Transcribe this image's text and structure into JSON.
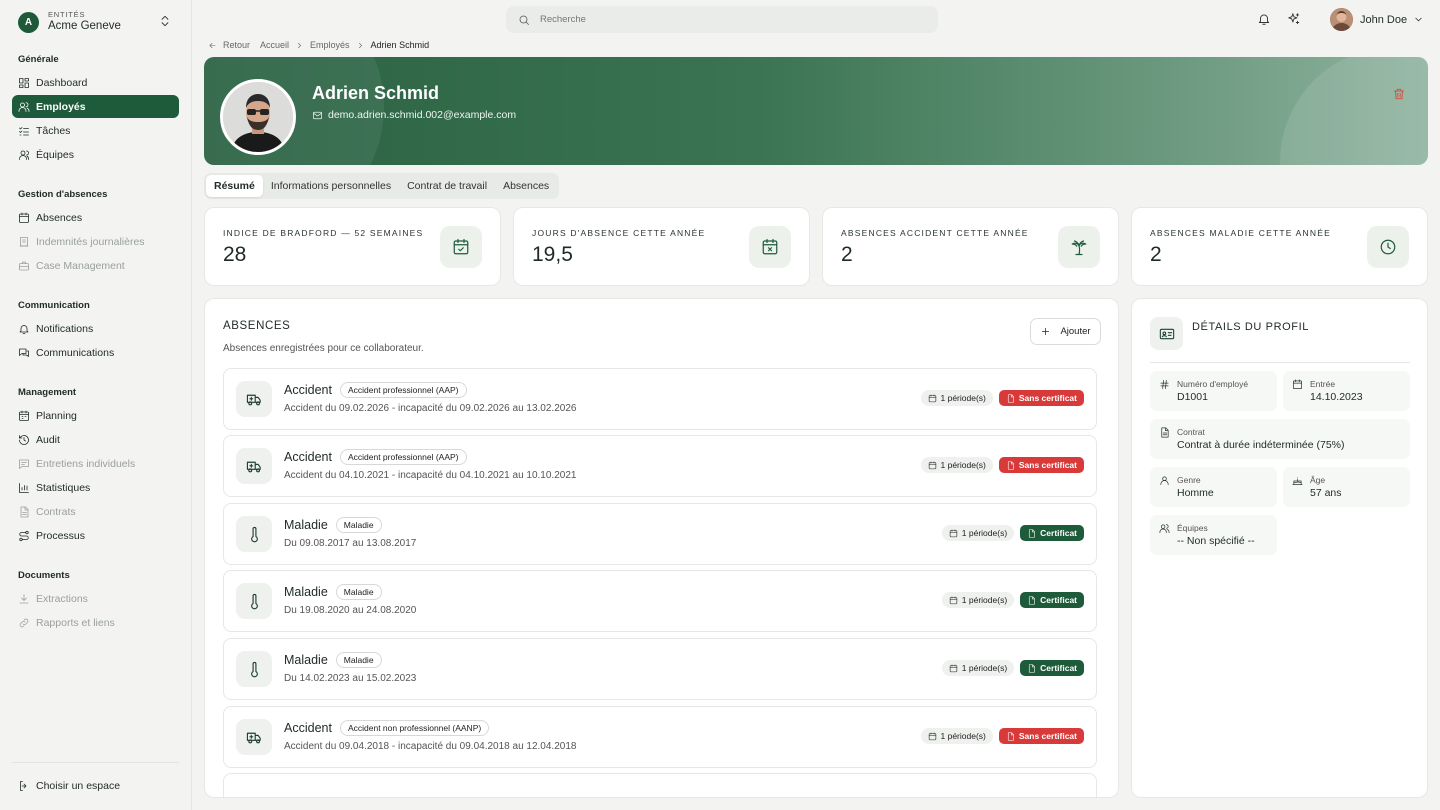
{
  "sidebar": {
    "entity_label": "ENTITÉS",
    "entity_name": "Acme Geneve",
    "entity_initial": "A",
    "sections": {
      "generale": "Générale",
      "absences": "Gestion d'absences",
      "communication": "Communication",
      "management": "Management",
      "documents": "Documents"
    },
    "items": {
      "dashboard": "Dashboard",
      "employes": "Employés",
      "taches": "Tâches",
      "equipes": "Équipes",
      "absences": "Absences",
      "indemnites": "Indemnités journalières",
      "case_management": "Case Management",
      "notifications": "Notifications",
      "communications": "Communications",
      "planning": "Planning",
      "audit": "Audit",
      "entretiens": "Entretiens individuels",
      "statistiques": "Statistiques",
      "contrats": "Contrats",
      "processus": "Processus",
      "extractions": "Extractions",
      "rapports": "Rapports et liens"
    },
    "footer": "Choisir un espace"
  },
  "topbar": {
    "search_placeholder": "Recherche",
    "user_name": "John Doe"
  },
  "breadcrumb": {
    "back": "Retour",
    "home": "Accueil",
    "employees": "Employés",
    "current": "Adrien Schmid"
  },
  "profile": {
    "name": "Adrien Schmid",
    "email": "demo.adrien.schmid.002@example.com"
  },
  "tabs": [
    "Résumé",
    "Informations personnelles",
    "Contrat de travail",
    "Absences"
  ],
  "stats": [
    {
      "label": "Indice de Bradford — 52 semaines",
      "value": "28",
      "icon": "calendar-check-icon"
    },
    {
      "label": "Jours d'absence cette année",
      "value": "19,5",
      "icon": "calendar-x-icon"
    },
    {
      "label": "Absences accident cette année",
      "value": "2",
      "icon": "palm-tree-icon"
    },
    {
      "label": "Absences maladie cette année",
      "value": "2",
      "icon": "clock-icon"
    }
  ],
  "absences": {
    "title": "ABSENCES",
    "subtitle": "Absences enregistrées pour ce collaborateur.",
    "add_label": "Ajouter",
    "items": [
      {
        "type": "Accident",
        "badge": "Accident professionnel (AAP)",
        "desc": "Accident du 09.02.2026 - incapacité du 09.02.2026 au 13.02.2026",
        "periods": "1 période(s)",
        "cert": "Sans certificat",
        "icon": "ambulance-icon"
      },
      {
        "type": "Accident",
        "badge": "Accident professionnel (AAP)",
        "desc": "Accident du 04.10.2021 - incapacité du 04.10.2021 au 10.10.2021",
        "periods": "1 période(s)",
        "cert": "Sans certificat",
        "icon": "ambulance-icon"
      },
      {
        "type": "Maladie",
        "badge": "Maladie",
        "desc": "Du 09.08.2017 au 13.08.2017",
        "periods": "1 période(s)",
        "cert": "Certificat",
        "icon": "thermometer-icon"
      },
      {
        "type": "Maladie",
        "badge": "Maladie",
        "desc": "Du 19.08.2020 au 24.08.2020",
        "periods": "1 période(s)",
        "cert": "Certificat",
        "icon": "thermometer-icon"
      },
      {
        "type": "Maladie",
        "badge": "Maladie",
        "desc": "Du 14.02.2023 au 15.02.2023",
        "periods": "1 période(s)",
        "cert": "Certificat",
        "icon": "thermometer-icon"
      },
      {
        "type": "Accident",
        "badge": "Accident non professionnel (AANP)",
        "desc": "Accident du 09.04.2018 - incapacité du 09.04.2018 au 12.04.2018",
        "periods": "1 période(s)",
        "cert": "Sans certificat",
        "icon": "ambulance-icon"
      }
    ]
  },
  "details": {
    "title": "DÉTAILS DU PROFIL",
    "employee_number_label": "Numéro d'employé",
    "employee_number": "D1001",
    "entry_label": "Entrée",
    "entry": "14.10.2023",
    "contract_label": "Contrat",
    "contract": "Contrat à durée indéterminée (75%)",
    "gender_label": "Genre",
    "gender": "Homme",
    "age_label": "Âge",
    "age": "57 ans",
    "teams_label": "Équipes",
    "teams": "-- Non spécifié --"
  },
  "colors": {
    "brand": "#1d5b3b",
    "danger": "#d83a3a",
    "background": "#f3f4f2"
  }
}
